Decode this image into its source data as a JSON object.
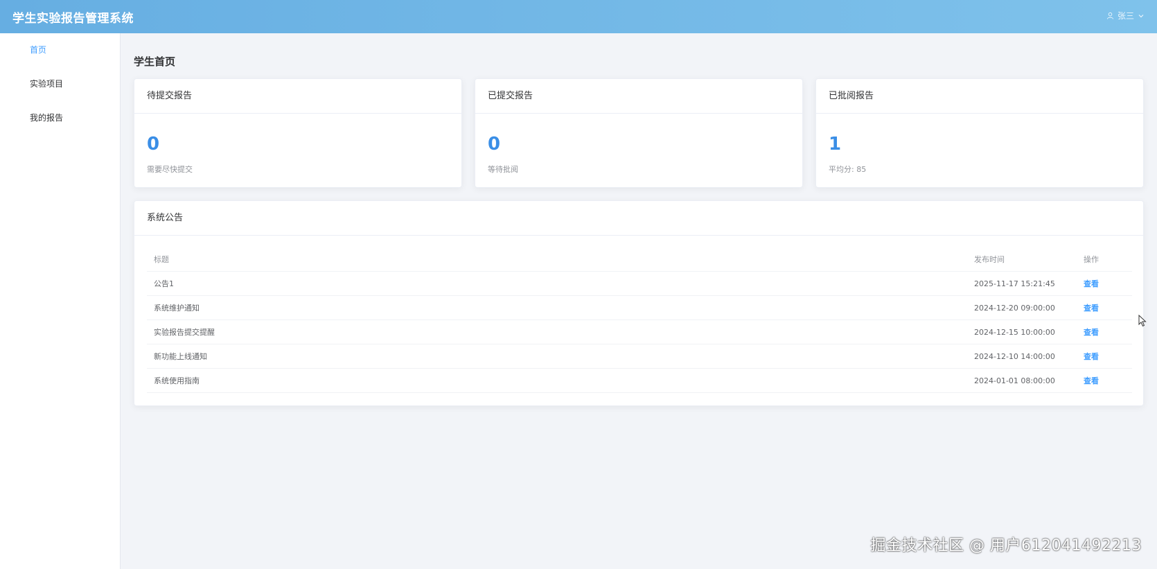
{
  "header": {
    "app_title": "学生实验报告管理系统",
    "user_name": "张三"
  },
  "sidebar": {
    "items": [
      {
        "label": "首页",
        "active": true
      },
      {
        "label": "实验项目",
        "active": false
      },
      {
        "label": "我的报告",
        "active": false
      }
    ]
  },
  "main": {
    "page_title": "学生首页",
    "stats": [
      {
        "title": "待提交报告",
        "value": "0",
        "desc": "需要尽快提交"
      },
      {
        "title": "已提交报告",
        "value": "0",
        "desc": "等待批阅"
      },
      {
        "title": "已批阅报告",
        "value": "1",
        "desc": "平均分: 85"
      }
    ],
    "notice": {
      "title": "系统公告",
      "columns": {
        "title": "标题",
        "time": "发布时间",
        "op": "操作"
      },
      "rows": [
        {
          "title": "公告1",
          "time": "2025-11-17 15:21:45",
          "op": "查看"
        },
        {
          "title": "系统维护通知",
          "time": "2024-12-20 09:00:00",
          "op": "查看"
        },
        {
          "title": "实验报告提交提醒",
          "time": "2024-12-15 10:00:00",
          "op": "查看"
        },
        {
          "title": "新功能上线通知",
          "time": "2024-12-10 14:00:00",
          "op": "查看"
        },
        {
          "title": "系统使用指南",
          "time": "2024-01-01 08:00:00",
          "op": "查看"
        }
      ]
    }
  },
  "watermark": "掘金技术社区 @ 用户612041492213",
  "colors": {
    "header_start": "#66aee2",
    "header_end": "#7fc2eb",
    "accent": "#409eff",
    "stat_value": "#3a8ee6"
  }
}
